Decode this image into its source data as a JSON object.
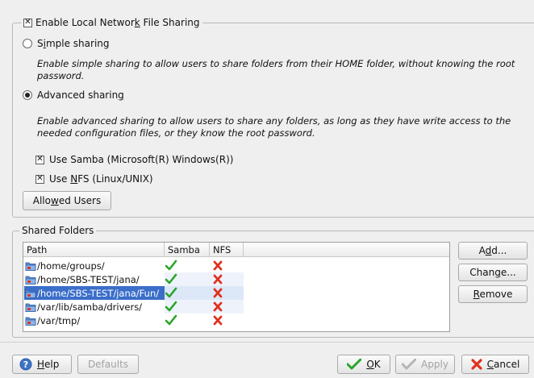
{
  "sharing": {
    "enable_label_pre": "Enable Local Networ",
    "enable_label_key": "k",
    "enable_label_post": " File Sharing",
    "enable_checked": true,
    "simple": {
      "label_pre": "S",
      "label_key": "i",
      "label_post": "mple sharing",
      "selected": false,
      "description": "Enable simple sharing to allow users to share folders from their HOME folder, without knowing the root password."
    },
    "advanced": {
      "label_pre": "Advanced sharin",
      "label_key": "g",
      "label_post": "",
      "selected": true,
      "description": "Enable advanced sharing to allow users to share any folders, as long as they have write access to the needed configuration files, or they know the root password."
    },
    "samba_label": "Use Samba (Microsoft(R) Windows(R))",
    "samba_checked": true,
    "nfs_label_pre": "Use ",
    "nfs_label_key": "N",
    "nfs_label_post": "FS (Linux/UNIX)",
    "nfs_checked": true,
    "allowed_users": {
      "pre": "Allo",
      "key": "w",
      "post": "ed Users"
    }
  },
  "shared_folders": {
    "title": "Shared Folders",
    "columns": [
      "Path",
      "Samba",
      "NFS"
    ],
    "rows": [
      {
        "path": "/home/groups/",
        "samba": true,
        "nfs": false,
        "selected": false
      },
      {
        "path": "/home/SBS-TEST/jana/",
        "samba": true,
        "nfs": false,
        "selected": false
      },
      {
        "path": "/home/SBS-TEST/jana/Fun/",
        "samba": true,
        "nfs": false,
        "selected": true
      },
      {
        "path": "/var/lib/samba/drivers/",
        "samba": true,
        "nfs": false,
        "selected": false
      },
      {
        "path": "/var/tmp/",
        "samba": true,
        "nfs": false,
        "selected": false
      }
    ],
    "buttons": {
      "add": {
        "pre": "A",
        "key": "d",
        "post": "d..."
      },
      "change": {
        "pre": "Chan",
        "key": "g",
        "post": "e..."
      },
      "remove": {
        "pre": "",
        "key": "R",
        "post": "emove"
      }
    }
  },
  "footer": {
    "help": {
      "pre": "",
      "key": "H",
      "post": "elp"
    },
    "defaults": "Defaults",
    "ok": {
      "pre": "",
      "key": "O",
      "post": "K"
    },
    "apply": "Apply",
    "cancel": {
      "pre": "",
      "key": "C",
      "post": "ancel"
    }
  },
  "colors": {
    "check_green": "#2aa52a",
    "cross_red": "#e0301e",
    "selection": "#3a6ec9"
  }
}
